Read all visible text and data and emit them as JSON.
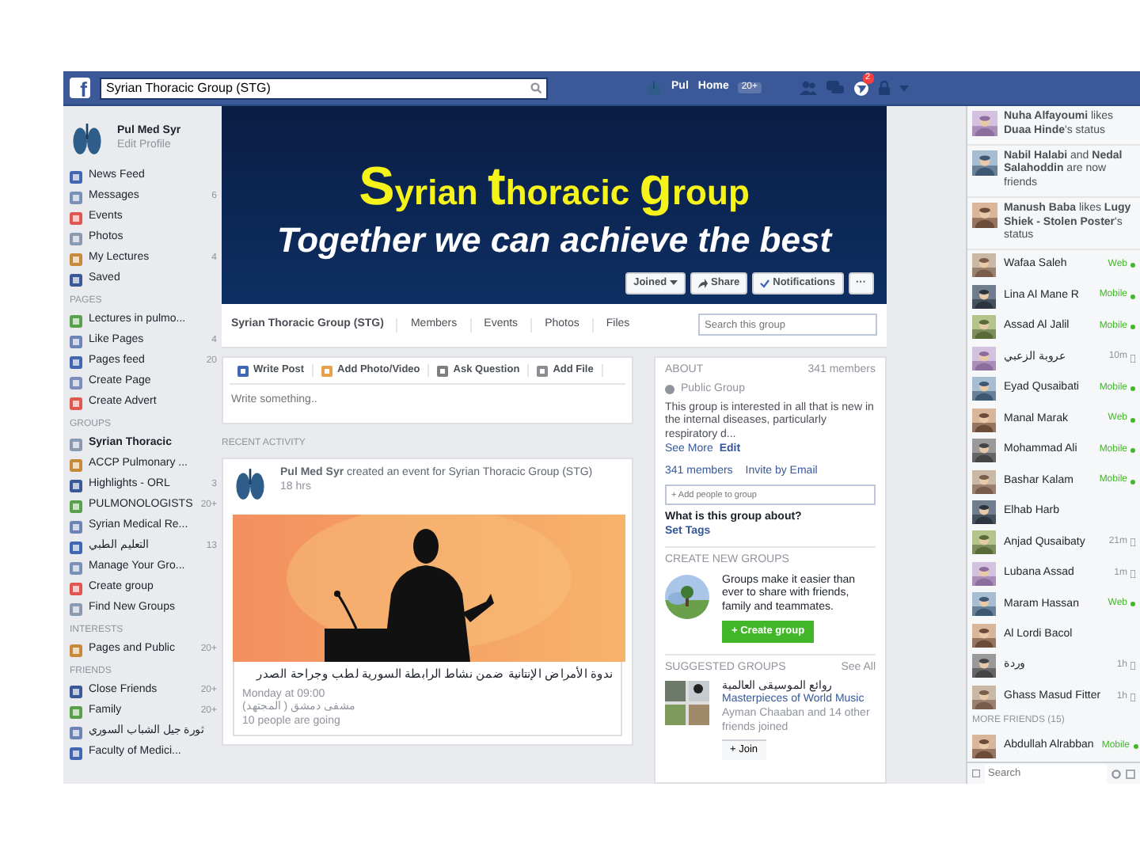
{
  "top_bar": {
    "logo": "f",
    "search_value": "Syrian Thoracic Group (STG)",
    "user": "Pul",
    "home": "Home",
    "home_count": "20+",
    "notification_count": "2"
  },
  "sidebar": {
    "profile": {
      "name": "Pul Med Syr",
      "link": "Edit Profile"
    },
    "sections": [
      {
        "items": [
          {
            "label": "News Feed",
            "selected": false
          },
          {
            "label": "Messages",
            "count": "6",
            "selected": false
          },
          {
            "label": "Events",
            "selected": false
          },
          {
            "label": "Photos",
            "selected": false
          },
          {
            "label": "My Lectures",
            "count": "4",
            "selected": false
          },
          {
            "label": "Saved",
            "selected": false
          }
        ]
      },
      {
        "heading": "PAGES",
        "items": [
          {
            "label": "Lectures in pulmo...",
            "selected": false
          },
          {
            "label": "Like Pages",
            "count": "4",
            "selected": false
          },
          {
            "label": "Pages feed",
            "count": "20",
            "selected": false
          },
          {
            "label": "Create Page",
            "selected": false
          },
          {
            "label": "Create Advert",
            "selected": false
          }
        ]
      },
      {
        "heading": "GROUPS",
        "items": [
          {
            "label": "Syrian Thoracic",
            "selected": true
          },
          {
            "label": "ACCP Pulmonary ...",
            "selected": false
          },
          {
            "label": "Highlights - ORL",
            "count": "3",
            "selected": false
          },
          {
            "label": "PULMONOLOGISTS",
            "count": "20+",
            "selected": false
          },
          {
            "label": "Syrian Medical Re...",
            "selected": false
          },
          {
            "label": "التعليم الطبي",
            "count": "13",
            "selected": false
          },
          {
            "label": "Manage Your Gro...",
            "selected": false
          },
          {
            "label": "Create group",
            "selected": false
          },
          {
            "label": "Find New Groups",
            "selected": false
          }
        ]
      },
      {
        "heading": "INTERESTS",
        "items": [
          {
            "label": "Pages and Public",
            "count": "20+",
            "selected": false
          }
        ]
      },
      {
        "heading": "FRIENDS",
        "items": [
          {
            "label": "Close Friends",
            "count": "20+",
            "selected": false
          },
          {
            "label": "Family",
            "count": "20+",
            "selected": false
          },
          {
            "label": "ثورة جيل الشباب السوري",
            "selected": false
          },
          {
            "label": "Faculty of Medici...",
            "selected": false
          }
        ]
      }
    ]
  },
  "cover": {
    "title_words": [
      {
        "initial": "S",
        "rest": "yrian"
      },
      {
        "initial": "t",
        "rest": "horacic"
      },
      {
        "initial": "g",
        "rest": "roup"
      }
    ],
    "tagline": "Together we can achieve the best",
    "buttons": [
      {
        "label": "Joined",
        "kind": "dropdown"
      },
      {
        "label": "Share",
        "kind": "share"
      },
      {
        "label": "Notifications",
        "kind": "check"
      },
      {
        "label": "···",
        "kind": "more"
      }
    ]
  },
  "group_nav": {
    "group_name": "Syrian Thoracic Group (STG)",
    "tabs": [
      {
        "label": "Members",
        "selected": false
      },
      {
        "label": "Events",
        "selected": false
      },
      {
        "label": "Photos",
        "selected": false
      },
      {
        "label": "Files",
        "selected": false
      }
    ],
    "search_placeholder": "Search this group"
  },
  "composer": {
    "actions": [
      {
        "label": "Write Post",
        "kind": "post"
      },
      {
        "label": "Add Photo/Video"
      },
      {
        "label": "Ask Question",
        "kind": "question"
      },
      {
        "label": "Add File",
        "kind": "file"
      }
    ],
    "placeholder": "Write something.."
  },
  "feed": {
    "heading": "RECENT ACTIVITY",
    "post": {
      "headline": "**Pul Med Syr** created an event for Syrian Thoracic Group (STG)",
      "time": "18 hrs",
      "event_title": "ندوة الأمراض الإنتانية ضمن نشاط الرابطة السورية لطب وجراحة الصدر",
      "event_time": "Monday at 09:00",
      "event_place": "مشفى دمشق ( المجتهد)",
      "going": "10 people are going"
    }
  },
  "about": {
    "heading": "ABOUT",
    "members": "341 members",
    "privacy": "Public Group",
    "description": "This group is interested in all that is new in the internal diseases, particularly respiratory d...",
    "see_more": "See More",
    "edit": "Edit",
    "member_count": "341 members",
    "invite": "Invite by Email",
    "add_placeholder": "+ Add people to group",
    "tags_question": "What is this group about?",
    "set_tags": "Set Tags"
  },
  "create_groups": {
    "heading": "CREATE NEW GROUPS",
    "text": "Groups make it easier than ever to share with friends, family and teammates.",
    "button": "+ Create group"
  },
  "suggested": {
    "heading": "SUGGESTED GROUPS",
    "see_all": "See All",
    "group_arabic": "روائع الموسيقى العالمية",
    "group_name": "Masterpieces of World Music",
    "joined": "Ayman Chaaban and 14 other friends joined",
    "join": "+ Join"
  },
  "chat": {
    "ticker": [
      {
        "text": "**Nuha Alfayoumi** likes **Duaa Hinde**'s status"
      },
      {
        "text": "**Nabil Halabi** and **Nedal Salahoddin** are now friends"
      },
      {
        "text": "**Manush Baba** likes **Lugy Shiek - Stolen Poster**'s status"
      }
    ],
    "contacts": [
      {
        "name": "Wafaa Saleh",
        "kind": "web",
        "status": "Web"
      },
      {
        "name": "Lina Al Mane R",
        "kind": "mobile",
        "status": "Mobile"
      },
      {
        "name": "Assad Al Jalil",
        "kind": "mobile",
        "status": "Mobile"
      },
      {
        "name": "عروبة الزعبي",
        "kind": "idle",
        "status": "10m"
      },
      {
        "name": "Eyad Qusaibati",
        "kind": "mobile",
        "status": "Mobile"
      },
      {
        "name": "Manal Marak",
        "kind": "web",
        "status": "Web"
      },
      {
        "name": "Mohammad Ali",
        "kind": "mobile",
        "status": "Mobile"
      },
      {
        "name": "Bashar Kalam",
        "kind": "mobile",
        "status": "Mobile"
      },
      {
        "name": "Elhab Harb",
        "kind": "offline"
      },
      {
        "name": "Anjad Qusaibaty",
        "kind": "idle",
        "status": "21m"
      },
      {
        "name": "Lubana Assad",
        "kind": "idle",
        "status": "1m"
      },
      {
        "name": "Maram Hassan",
        "kind": "web",
        "status": "Web"
      },
      {
        "name": "Al Lordi Bacol",
        "kind": "offline"
      },
      {
        "name": "وردة",
        "kind": "idle",
        "status": "1h"
      },
      {
        "name": "Ghass Masud Fitter",
        "kind": "idle",
        "status": "1h"
      }
    ],
    "more_heading": "MORE FRIENDS (15)",
    "more_contacts": [
      {
        "name": "Abdullah Alrabban",
        "kind": "mobile",
        "status": "Mobile"
      }
    ],
    "search_placeholder": "Search"
  }
}
